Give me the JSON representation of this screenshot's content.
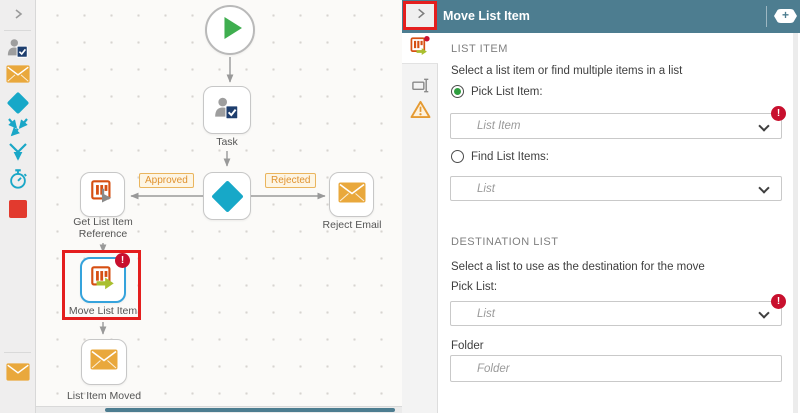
{
  "sidebar": {
    "items": [
      {
        "icon": "collapse-chevron-icon"
      },
      {
        "icon": "user-task-icon"
      },
      {
        "icon": "email-icon"
      },
      {
        "icon": "decision-diamond-icon"
      },
      {
        "icon": "merge-arrows-icon"
      },
      {
        "icon": "converge-arrows-icon"
      },
      {
        "icon": "timer-icon"
      },
      {
        "icon": "stop-square-icon"
      },
      {
        "icon": "email-icon"
      }
    ]
  },
  "canvas": {
    "nodes": [
      {
        "id": "start",
        "label": ""
      },
      {
        "id": "task",
        "label": "Task"
      },
      {
        "id": "decision",
        "label": ""
      },
      {
        "id": "get-list-item-reference",
        "label": "Get List Item Reference"
      },
      {
        "id": "reject-email",
        "label": "Reject Email"
      },
      {
        "id": "move-list-item",
        "label": "Move List Item"
      },
      {
        "id": "list-item-moved",
        "label": "List Item Moved"
      }
    ],
    "edge_labels": {
      "approved": "Approved",
      "rejected": "Rejected"
    },
    "error_glyph": "!"
  },
  "panel": {
    "title": "Move List Item",
    "add_button_glyph": "+",
    "tabs": [
      {
        "icon": "move-list-item-icon"
      },
      {
        "icon": "rename-icon"
      },
      {
        "icon": "warning-icon"
      }
    ],
    "list_item": {
      "heading": "LIST ITEM",
      "description": "Select a list item or find multiple items in a list",
      "pick_label": "Pick List Item:",
      "pick_placeholder": "List Item",
      "find_label": "Find List Items:",
      "find_placeholder": "List",
      "error_glyph": "!"
    },
    "destination": {
      "heading": "DESTINATION LIST",
      "description": "Select a list to use as the destination for the move",
      "pick_label": "Pick List:",
      "pick_placeholder": "List",
      "folder_label": "Folder",
      "folder_placeholder": "Folder",
      "error_glyph": "!"
    }
  },
  "colors": {
    "header_teal": "#4d7d90",
    "annotation_red": "#e41e1e",
    "error_red": "#c8102e",
    "accent_teal": "#17a8c8",
    "orange": "#e9a83c",
    "list_orange": "#d64f12",
    "play_green": "#3fae4f",
    "selected_blue": "#35a3dc",
    "arrow_green": "#a9bf2f"
  }
}
